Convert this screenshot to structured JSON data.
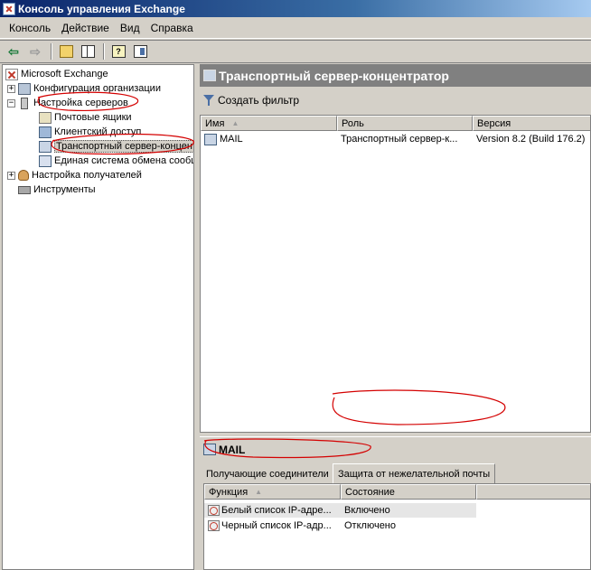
{
  "window": {
    "title": "Консоль управления Exchange"
  },
  "menu": [
    {
      "label": "Консоль"
    },
    {
      "label": "Действие"
    },
    {
      "label": "Вид"
    },
    {
      "label": "Справка"
    }
  ],
  "tree": {
    "root": "Microsoft Exchange",
    "org_config": "Конфигурация организации",
    "server_config": "Настройка серверов",
    "mailboxes": "Почтовые ящики",
    "client_access": "Клиентский доступ",
    "hub_transport": "Транспортный сервер-концентратор",
    "unified_messaging": "Единая система обмена сообщениями",
    "recipient_config": "Настройка получателей",
    "tools": "Инструменты"
  },
  "main": {
    "title": "Транспортный сервер-концентратор",
    "action": "Создать фильтр",
    "columns": [
      "Имя",
      "Роль",
      "Версия"
    ],
    "rows": [
      {
        "name": "MAIL",
        "role": "Транспортный сервер-к...",
        "version": "Version 8.2 (Build 176.2)"
      }
    ]
  },
  "detail": {
    "title": "MAIL",
    "tabs": [
      "Получающие соединители",
      "Защита от нежелательной почты"
    ],
    "columns": [
      "Функция",
      "Состояние"
    ],
    "rows": [
      {
        "feature": "Белый список IP-адре...",
        "state": "Включено"
      },
      {
        "feature": "Черный список IP-адр...",
        "state": "Отключено"
      }
    ]
  },
  "colors": {
    "annotation": "#d40000",
    "header_bg": "#808080"
  }
}
